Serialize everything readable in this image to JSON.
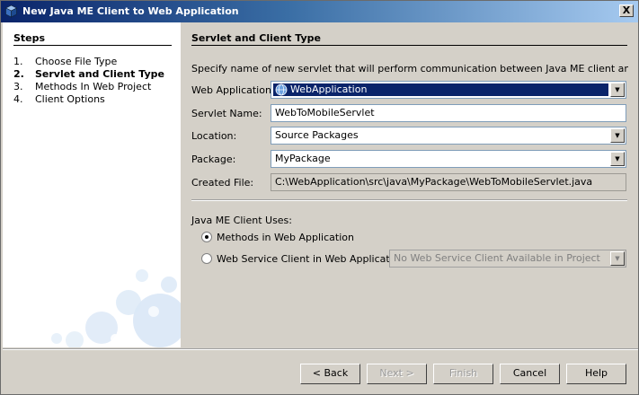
{
  "window": {
    "title": "New Java ME Client to Web Application",
    "close_label": "X"
  },
  "steps": {
    "title": "Steps",
    "items": [
      {
        "num": "1.",
        "label": "Choose File Type"
      },
      {
        "num": "2.",
        "label": "Servlet and Client Type"
      },
      {
        "num": "3.",
        "label": "Methods In Web Project"
      },
      {
        "num": "4.",
        "label": "Client Options"
      }
    ]
  },
  "panel": {
    "heading": "Servlet and Client Type",
    "description": "Specify name of new servlet that will perform communication between Java ME client and web appl..."
  },
  "form": {
    "web_application": {
      "label": "Web Application:",
      "value": "WebApplication"
    },
    "servlet_name": {
      "label": "Servlet Name:",
      "value": "WebToMobileServlet"
    },
    "location": {
      "label": "Location:",
      "value": "Source Packages"
    },
    "package": {
      "label": "Package:",
      "value": "MyPackage"
    },
    "created_file": {
      "label": "Created File:",
      "value": "C:\\WebApplication\\src\\java\\MyPackage\\WebToMobileServlet.java"
    }
  },
  "client_uses": {
    "label": "Java ME Client Uses:",
    "option_methods": "Methods in Web Application",
    "option_service": "Web Service Client in Web Application:",
    "service_placeholder": "No Web Service Client Available in Project"
  },
  "buttons": {
    "back": "< Back",
    "next": "Next >",
    "finish": "Finish",
    "cancel": "Cancel",
    "help": "Help"
  },
  "colors": {
    "title_bar": "#0a246a",
    "selection": "#0a246a",
    "dialog_bg": "#d4d0c8"
  }
}
